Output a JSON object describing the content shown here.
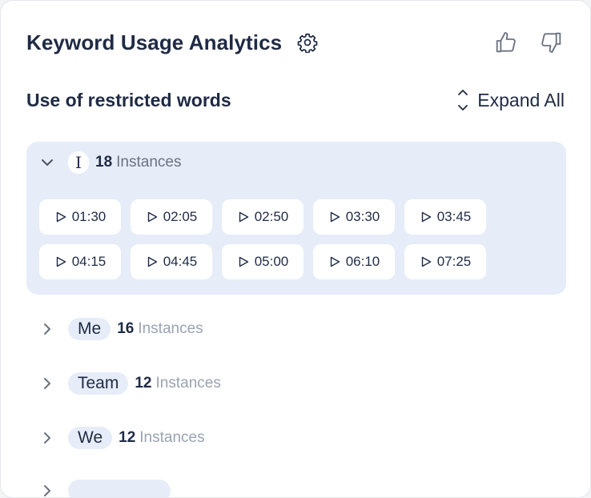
{
  "header": {
    "title": "Keyword Usage Analytics"
  },
  "section": {
    "title": "Use of restricted words",
    "expand_label": "Expand All"
  },
  "groups": [
    {
      "word": "I",
      "count": "18",
      "instances_label": "Instances",
      "expanded": true,
      "timestamps": [
        "01:30",
        "02:05",
        "02:50",
        "03:30",
        "03:45",
        "04:15",
        "04:45",
        "05:00",
        "06:10",
        "07:25"
      ]
    },
    {
      "word": "Me",
      "count": "16",
      "instances_label": "Instances",
      "expanded": false
    },
    {
      "word": "Team",
      "count": "12",
      "instances_label": "Instances",
      "expanded": false
    },
    {
      "word": "We",
      "count": "12",
      "instances_label": "Instances",
      "expanded": false
    }
  ],
  "colors": {
    "text": "#1f2a44",
    "muted": "#6b7280",
    "tint": "#e6edf8",
    "icon": "#6b7280"
  },
  "icons": [
    "gear-icon",
    "thumbs-up-icon",
    "thumbs-down-icon",
    "chevron-up-down-icon",
    "chevron-down-icon",
    "chevron-right-icon",
    "play-icon"
  ]
}
